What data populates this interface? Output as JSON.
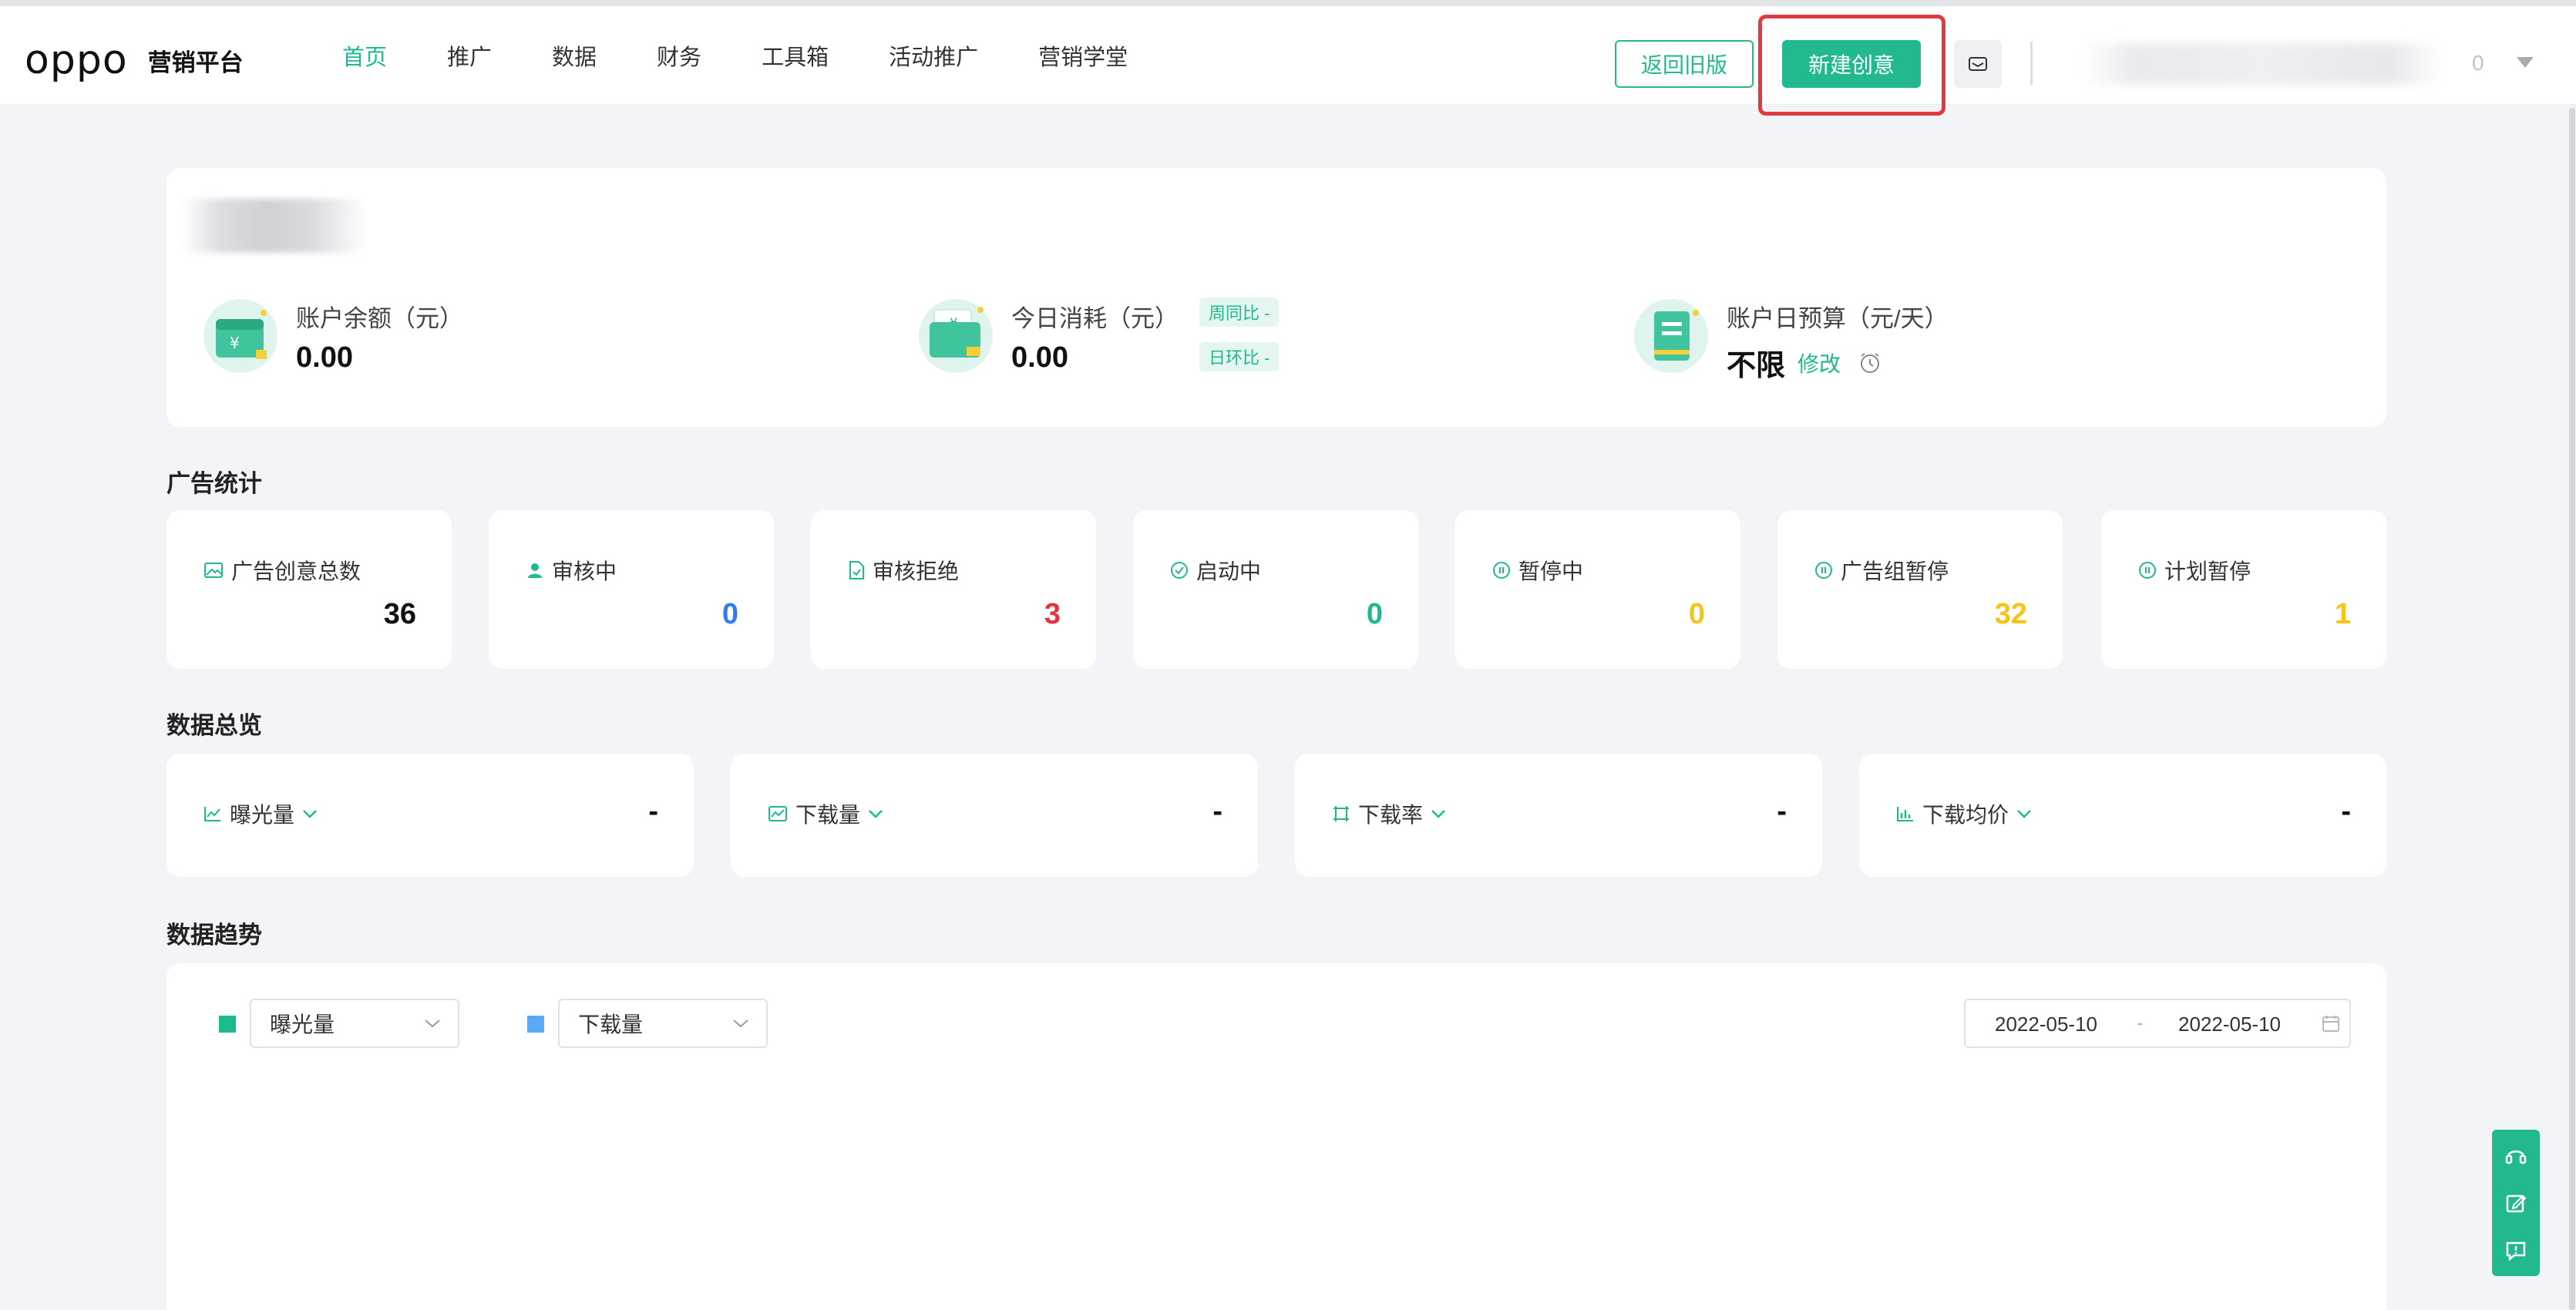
{
  "header": {
    "logo_text": "oppo",
    "platform_name": "营销平台",
    "nav": [
      {
        "label": "首页",
        "active": true
      },
      {
        "label": "推广",
        "active": false
      },
      {
        "label": "数据",
        "active": false
      },
      {
        "label": "财务",
        "active": false
      },
      {
        "label": "工具箱",
        "active": false
      },
      {
        "label": "活动推广",
        "active": false
      },
      {
        "label": "营销学堂",
        "active": false
      }
    ],
    "back_old_label": "返回旧版",
    "new_creative_label": "新建创意",
    "message_icon": "mail-icon",
    "user_count": "0"
  },
  "account": {
    "balance_label": "账户余额（元）",
    "balance_value": "0.00",
    "today_cost_label": "今日消耗（元）",
    "today_cost_value": "0.00",
    "wow_label": "周同比 -",
    "dod_label": "日环比 -",
    "daily_budget_label": "账户日预算（元/天）",
    "daily_budget_value": "不限",
    "edit_label": "修改"
  },
  "ad_stats": {
    "title": "广告统计",
    "items": [
      {
        "label": "广告创意总数",
        "value": "36",
        "color": "#111111",
        "icon": "image-icon"
      },
      {
        "label": "审核中",
        "value": "0",
        "color": "#2f7cf6",
        "icon": "user-icon"
      },
      {
        "label": "审核拒绝",
        "value": "3",
        "color": "#e3343f",
        "icon": "file-icon"
      },
      {
        "label": "启动中",
        "value": "0",
        "color": "#1fb990",
        "icon": "check-circle-icon"
      },
      {
        "label": "暂停中",
        "value": "0",
        "color": "#f5c515",
        "icon": "pause-circle-icon"
      },
      {
        "label": "广告组暂停",
        "value": "32",
        "color": "#f5c515",
        "icon": "pause-circle-icon"
      },
      {
        "label": "计划暂停",
        "value": "1",
        "color": "#f5c515",
        "icon": "pause-circle-icon"
      }
    ]
  },
  "overview": {
    "title": "数据总览",
    "items": [
      {
        "label": "曝光量",
        "value": "-",
        "icon": "line-chart-icon"
      },
      {
        "label": "下载量",
        "value": "-",
        "icon": "area-chart-icon"
      },
      {
        "label": "下载率",
        "value": "-",
        "icon": "frame-icon"
      },
      {
        "label": "下载均价",
        "value": "-",
        "icon": "bar-chart-icon"
      }
    ]
  },
  "trend": {
    "title": "数据趋势",
    "metric1": "曝光量",
    "metric1_color": "#1fb990",
    "metric2": "下载量",
    "metric2_color": "#5aa9f7",
    "date_start": "2022-05-10",
    "date_sep": "-",
    "date_end": "2022-05-10"
  },
  "colors": {
    "brand": "#23b98f",
    "highlight": "#e03a3e"
  }
}
